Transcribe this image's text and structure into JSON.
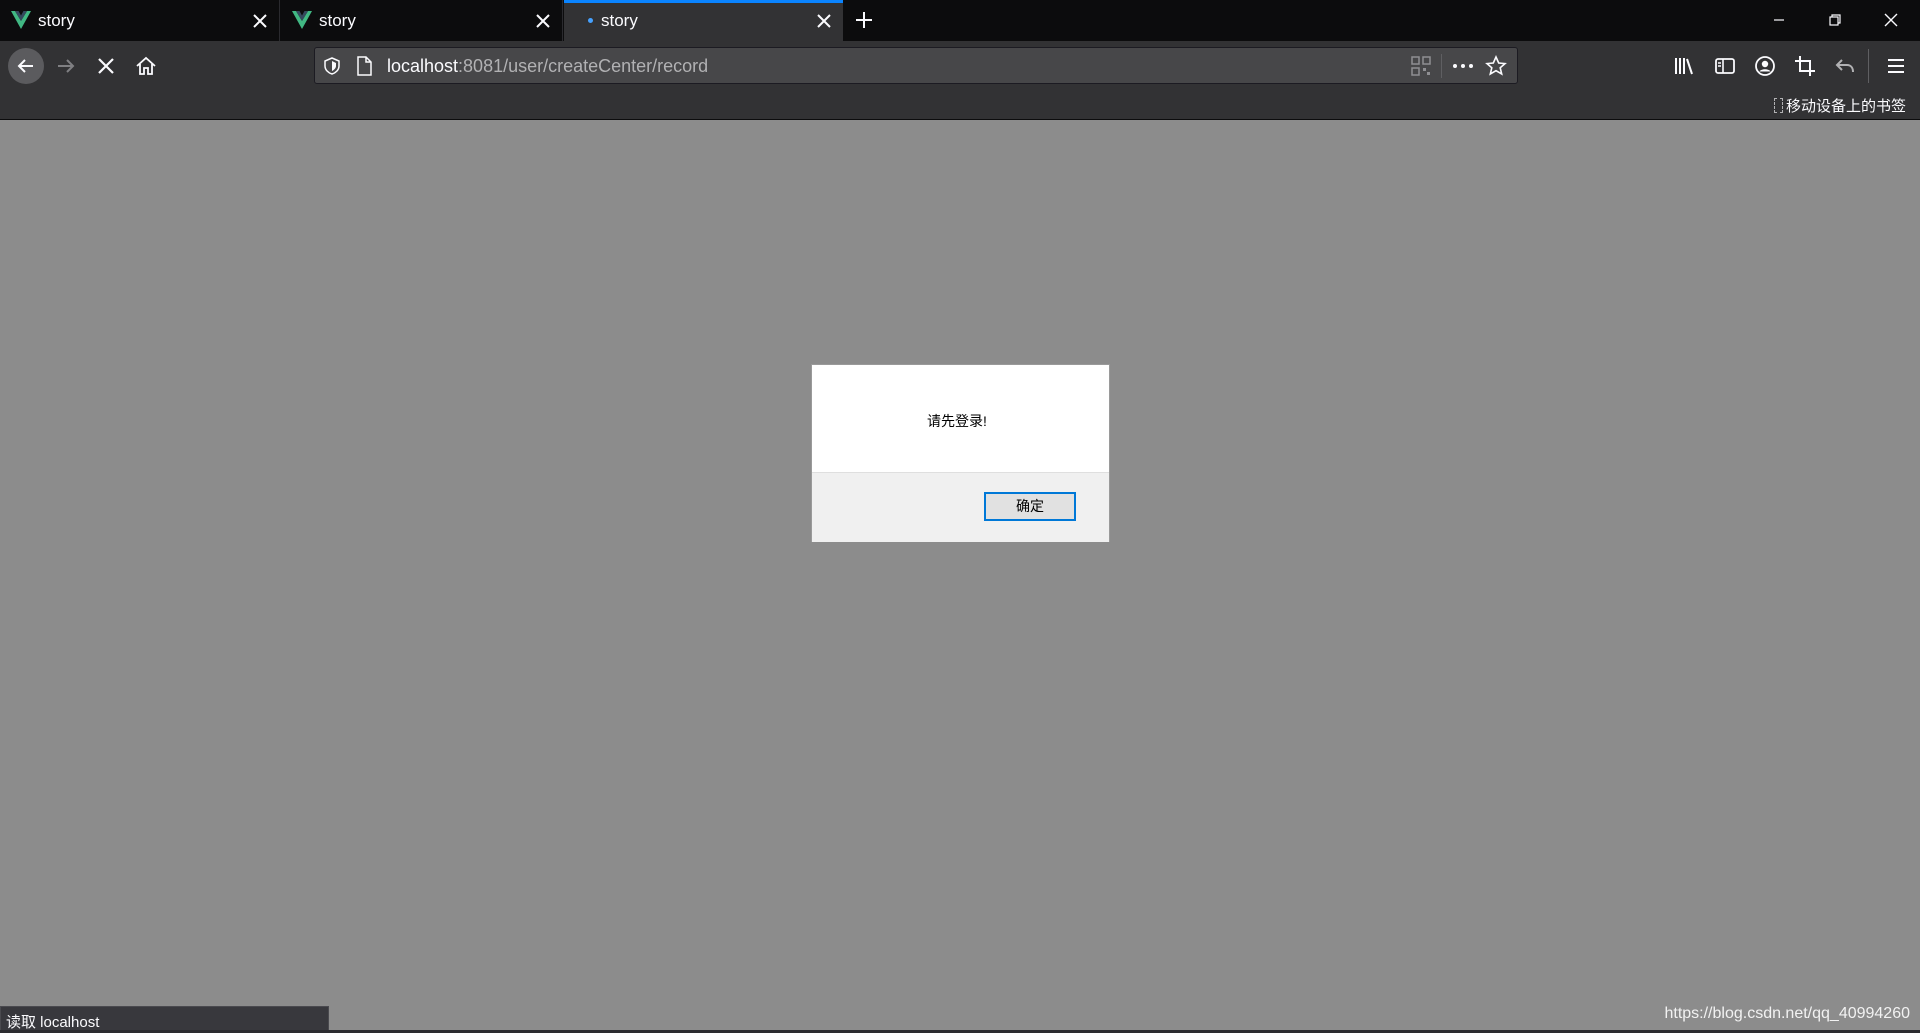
{
  "tabs": [
    {
      "title": "story",
      "icon": "vue-logo-icon",
      "state": "inactive"
    },
    {
      "title": "story",
      "icon": "vue-logo-icon",
      "state": "inactive"
    },
    {
      "title": "story",
      "icon": "loading-dot",
      "state": "active-loading"
    }
  ],
  "address_bar": {
    "host": "localhost",
    "path": ":8081/user/createCenter/record"
  },
  "bookmarks": {
    "mobile_label": "移动设备上的书签"
  },
  "dialog": {
    "message": "请先登录!",
    "ok_label": "确定"
  },
  "status": {
    "text": "读取 localhost"
  },
  "watermark": "https://blog.csdn.net/qq_40994260",
  "colors": {
    "accent": "#0a84ff",
    "page_overlay": "#8c8c8c",
    "toolbar": "#323234",
    "tabstrip": "#0c0c0d",
    "vue_green": "#41b883"
  }
}
